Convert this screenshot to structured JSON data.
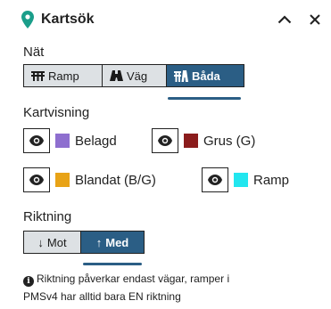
{
  "header": {
    "title": "Kartsök",
    "pin_color": "#1a9e8a"
  },
  "nat": {
    "label": "Nät",
    "options": [
      {
        "label": "Ramp",
        "icon": "ramp-icon",
        "active": false
      },
      {
        "label": "Väg",
        "icon": "road-icon",
        "active": false
      },
      {
        "label": "Båda",
        "icon": "both-icon",
        "active": true
      }
    ]
  },
  "kartvisning": {
    "label": "Kartvisning",
    "layers": [
      {
        "label": "Belagd",
        "color": "#8e6fcf"
      },
      {
        "label": "Grus (G)",
        "color": "#8b1c1c"
      },
      {
        "label": "Blandat (B/G)",
        "color": "#e8a317"
      },
      {
        "label": "Ramp",
        "color": "#22e6ef"
      }
    ]
  },
  "riktning": {
    "label": "Riktning",
    "options": [
      {
        "label": "Mot",
        "arrow": "↓",
        "active": false
      },
      {
        "label": "Med",
        "arrow": "↑",
        "active": true
      }
    ]
  },
  "info": {
    "line1": "Riktning påverkar endast vägar, ramper i",
    "line2": "PMSv4 har alltid bara EN riktning"
  },
  "colors": {
    "accent": "#2b5e85",
    "segment_bg": "#dde1e4"
  }
}
